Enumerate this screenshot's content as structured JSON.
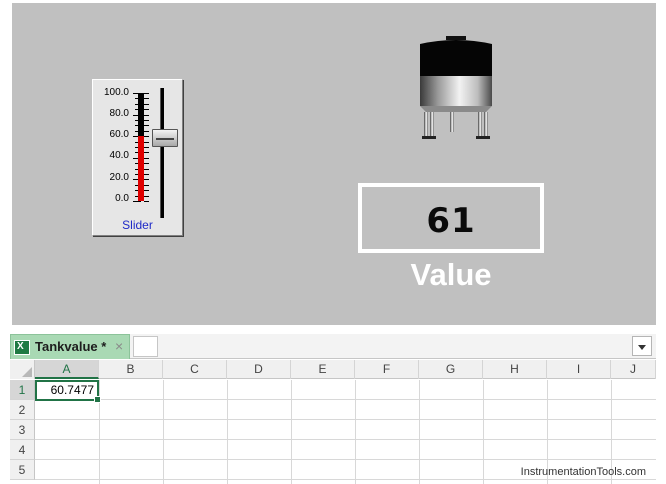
{
  "hmi": {
    "slider": {
      "caption": "Slider",
      "scale_labels": [
        "100.0",
        "80.0",
        "60.0",
        "40.0",
        "20.0",
        "0.0"
      ],
      "value_percent": 60,
      "fill_color": "#e00000",
      "caption_color": "#1f2ac8"
    },
    "tank": {
      "icon": "tank-icon"
    },
    "value_display": {
      "value": "61",
      "label": "Value"
    },
    "background_color": "#c0c0c0"
  },
  "spreadsheet": {
    "tab_label": "Tankvalue *",
    "tab_close": "×",
    "columns": [
      "A",
      "B",
      "C",
      "D",
      "E",
      "F",
      "G",
      "H",
      "I",
      "J"
    ],
    "rows": [
      "1",
      "2",
      "3",
      "4",
      "5"
    ],
    "cell_a1": "60.7477",
    "accent_color": "#217346"
  },
  "watermark": "InstrumentationTools.com"
}
